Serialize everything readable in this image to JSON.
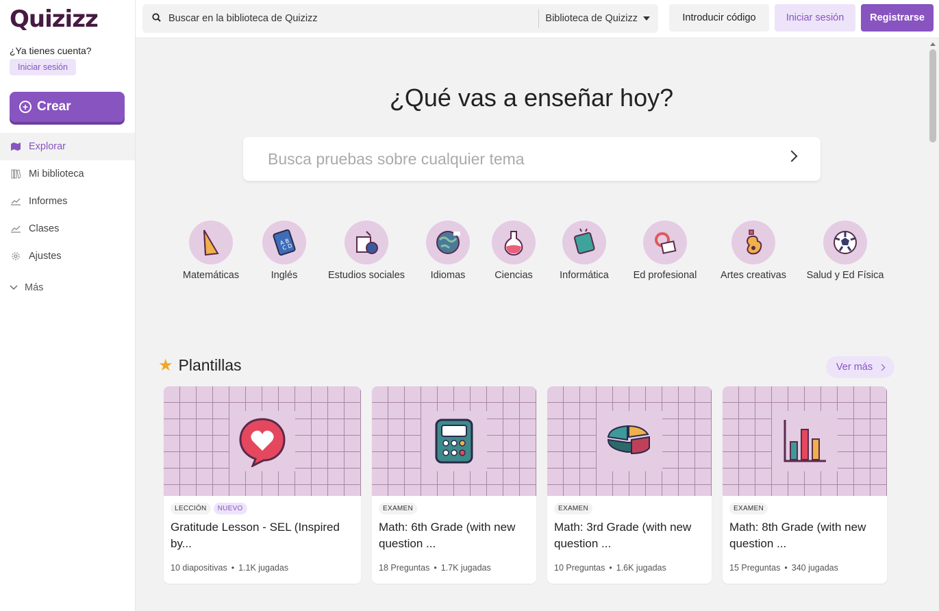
{
  "brand": {
    "name": "Quizizz",
    "accent": "#8854c0"
  },
  "sidebar": {
    "have_account": "¿Ya tienes cuenta?",
    "login_label": "Iniciar sesión",
    "create_label": "Crear",
    "items": [
      {
        "label": "Explorar",
        "icon": "explore-icon",
        "active": true
      },
      {
        "label": "Mi biblioteca",
        "icon": "library-icon"
      },
      {
        "label": "Informes",
        "icon": "reports-icon"
      },
      {
        "label": "Clases",
        "icon": "classes-icon"
      },
      {
        "label": "Ajustes",
        "icon": "settings-gear-icon"
      }
    ],
    "more_label": "Más"
  },
  "topbar": {
    "search_placeholder": "Buscar en la biblioteca de Quizizz",
    "library_select": "Biblioteca de Quizizz",
    "enter_code": "Introducir código",
    "login": "Iniciar sesión",
    "signup": "Registrarse"
  },
  "hero": {
    "title": "¿Qué vas a enseñar hoy?",
    "search_placeholder": "Busca pruebas sobre cualquier tema"
  },
  "subjects": [
    {
      "label": "Matemáticas",
      "icon": "math-icon"
    },
    {
      "label": "Inglés",
      "icon": "english-book-icon"
    },
    {
      "label": "Estudios sociales",
      "icon": "social-studies-icon"
    },
    {
      "label": "Idiomas",
      "icon": "globe-icon"
    },
    {
      "label": "Ciencias",
      "icon": "flask-icon"
    },
    {
      "label": "Informática",
      "icon": "computer-icon"
    },
    {
      "label": "Ed profesional",
      "icon": "professional-icon"
    },
    {
      "label": "Artes creativas",
      "icon": "arts-icon"
    },
    {
      "label": "Salud y Ed Física",
      "icon": "soccer-ball-icon"
    }
  ],
  "templates": {
    "title": "Plantillas",
    "see_more": "Ver más",
    "cards": [
      {
        "tags": [
          "LECCIÓN",
          "NUEVO"
        ],
        "title": "Gratitude Lesson - SEL (Inspired by...",
        "count": "10 diapositivas",
        "plays": "1.1K jugadas",
        "icon": "heart-bubble-icon"
      },
      {
        "tags": [
          "EXAMEN"
        ],
        "title": "Math: 6th Grade (with new question ...",
        "count": "18 Preguntas",
        "plays": "1.7K jugadas",
        "icon": "calculator-icon"
      },
      {
        "tags": [
          "EXAMEN"
        ],
        "title": "Math: 3rd Grade (with new question ...",
        "count": "10 Preguntas",
        "plays": "1.6K jugadas",
        "icon": "pie-chart-icon"
      },
      {
        "tags": [
          "EXAMEN"
        ],
        "title": "Math: 8th Grade (with new question ...",
        "count": "15 Preguntas",
        "plays": "340 jugadas",
        "icon": "bar-chart-icon"
      }
    ]
  }
}
